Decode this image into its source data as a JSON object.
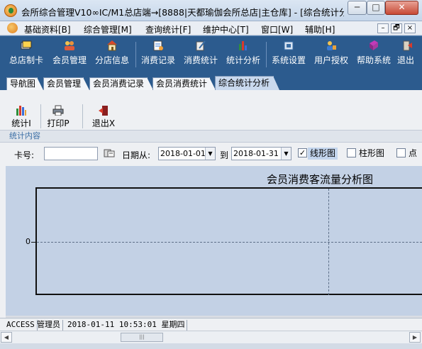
{
  "window": {
    "title": "会所综合管理V10∞IC/M1总店端→[8888|天都瑜伽会所总店|主仓库] - [综合统计分...",
    "min_label": "─",
    "max_label": "□",
    "close_label": "✕"
  },
  "menubar": {
    "items": [
      {
        "label": "基础资料[B]"
      },
      {
        "label": "综合管理[M]"
      },
      {
        "label": "查询统计[F]"
      },
      {
        "label": "维护中心[T]"
      },
      {
        "label": "窗口[W]"
      },
      {
        "label": "辅助[H]"
      }
    ],
    "mdi_min": "–",
    "mdi_restore": "🗗",
    "mdi_close": "×"
  },
  "toolbar": {
    "buttons": [
      {
        "label": "总店制卡",
        "icon": "card-icon"
      },
      {
        "label": "会员管理",
        "icon": "members-icon"
      },
      {
        "label": "分店信息",
        "icon": "store-icon"
      },
      {
        "label": "消费记录",
        "icon": "consumption-record-icon"
      },
      {
        "label": "消费统计",
        "icon": "consumption-stats-icon"
      },
      {
        "label": "统计分析",
        "icon": "analysis-icon"
      },
      {
        "label": "系统设置",
        "icon": "settings-icon"
      },
      {
        "label": "用户授权",
        "icon": "user-auth-icon"
      },
      {
        "label": "帮助系统",
        "icon": "help-icon"
      },
      {
        "label": "退出",
        "icon": "exit-icon"
      }
    ]
  },
  "tabs": [
    {
      "label": "导航图"
    },
    {
      "label": "会员管理"
    },
    {
      "label": "会员消费记录"
    },
    {
      "label": "会员消费统计"
    },
    {
      "label": "综合统计分析"
    }
  ],
  "subtoolbar": {
    "stats": "统计I",
    "print": "打印P",
    "exit": "退出X",
    "section": "统计内容"
  },
  "filter": {
    "card_label": "卡号:",
    "card_value": "",
    "date_from_label": "日期从:",
    "date_from": "2018-01-01",
    "to_label": "到",
    "date_to": "2018-01-31",
    "line_label": "线形图",
    "line_checked": true,
    "bar_label": "柱形图",
    "bar_checked": false,
    "point_label": "点",
    "point_checked": false,
    "check_mark": "✓"
  },
  "chart_data": {
    "type": "line",
    "title": "会员消费客流量分析图",
    "xlabel": "",
    "ylabel": "",
    "y_ticks": [
      "0"
    ],
    "series": [],
    "grid": true
  },
  "statusbar": {
    "db": "ACCESS",
    "user": "管理员",
    "datetime": "2018-01-11  10:53:01  星期四"
  },
  "scrollbar": {
    "left": "◀",
    "right": "▶",
    "thumb": "|||"
  }
}
